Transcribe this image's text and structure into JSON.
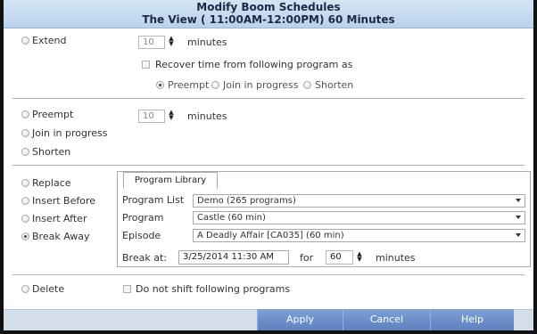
{
  "dialog": {
    "title": "Modify Boom Schedules",
    "subtitle": "The View ( 11:00AM-12:00PM) 60 Minutes"
  },
  "extend": {
    "label": "Extend",
    "value": "10",
    "unit": "minutes",
    "recover_label": "Recover time from following program as",
    "options": [
      "Preempt",
      "Join in progress",
      "Shorten"
    ],
    "selected_option": "Preempt"
  },
  "shift": {
    "preempt_label": "Preempt",
    "join_label": "Join in progress",
    "shorten_label": "Shorten",
    "value": "10",
    "unit": "minutes"
  },
  "replace_group": {
    "replace_label": "Replace",
    "insert_before_label": "Insert Before",
    "insert_after_label": "Insert After",
    "break_away_label": "Break Away",
    "selected": "Break Away"
  },
  "library": {
    "tab_label": "Program Library",
    "program_list_label": "Program List",
    "program_list_value": "Demo (265 programs)",
    "program_label": "Program",
    "program_value": "Castle (60 min)",
    "episode_label": "Episode",
    "episode_value": "A Deadly Affair [CA035] (60 min)",
    "break_at_label": "Break at:",
    "break_at_value": "3/25/2014 11:30 AM",
    "for_label": "for",
    "duration_value": "60",
    "unit": "minutes"
  },
  "delete": {
    "label": "Delete",
    "no_shift_label": "Do not shift following programs"
  },
  "footer": {
    "apply_label": "Apply",
    "cancel_label": "Cancel",
    "help_label": "Help"
  }
}
